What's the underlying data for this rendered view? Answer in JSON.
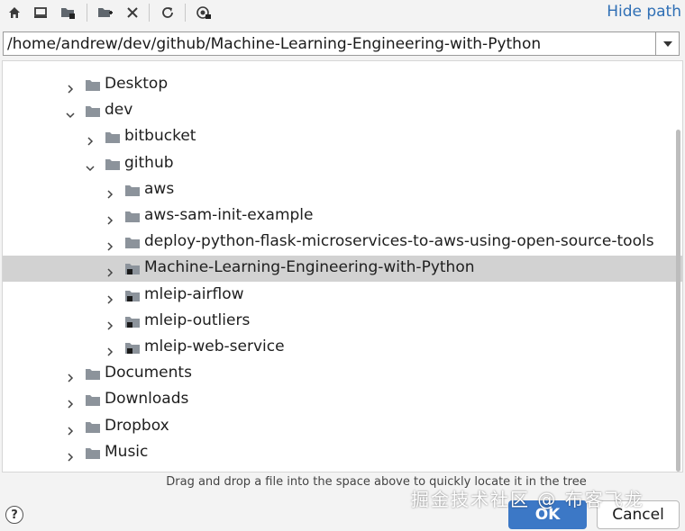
{
  "toolbar": {
    "buttons": [
      {
        "name": "home-icon"
      },
      {
        "name": "desktop-icon"
      },
      {
        "name": "project-folder-icon"
      },
      {
        "name": "new-folder-icon"
      },
      {
        "name": "delete-icon"
      },
      {
        "name": "refresh-icon"
      },
      {
        "name": "show-hidden-icon"
      }
    ],
    "hide_path_label": "Hide path"
  },
  "path": {
    "value": "/home/andrew/dev/github/Machine-Learning-Engineering-with-Python"
  },
  "tree": {
    "items": [
      {
        "label": "Desktop",
        "expanded": false,
        "icon": "folder-icon"
      },
      {
        "label": "dev",
        "expanded": true,
        "icon": "folder-icon"
      },
      {
        "label": "bitbucket",
        "expanded": false,
        "icon": "folder-icon"
      },
      {
        "label": "github",
        "expanded": true,
        "icon": "folder-icon"
      },
      {
        "label": "aws",
        "expanded": false,
        "icon": "folder-icon"
      },
      {
        "label": "aws-sam-init-example",
        "expanded": false,
        "icon": "folder-icon"
      },
      {
        "label": "deploy-python-flask-microservices-to-aws-using-open-source-tools",
        "expanded": false,
        "icon": "folder-icon"
      },
      {
        "label": "Machine-Learning-Engineering-with-Python",
        "expanded": false,
        "icon": "project-folder-icon",
        "selected": true
      },
      {
        "label": "mleip-airflow",
        "expanded": false,
        "icon": "project-folder-icon"
      },
      {
        "label": "mleip-outliers",
        "expanded": false,
        "icon": "project-folder-icon"
      },
      {
        "label": "mleip-web-service",
        "expanded": false,
        "icon": "project-folder-icon"
      },
      {
        "label": "Documents",
        "expanded": false,
        "icon": "folder-icon"
      },
      {
        "label": "Downloads",
        "expanded": false,
        "icon": "folder-icon"
      },
      {
        "label": "Dropbox",
        "expanded": false,
        "icon": "folder-icon"
      },
      {
        "label": "Music",
        "expanded": false,
        "icon": "folder-icon"
      }
    ]
  },
  "hint": "Drag and drop a file into the space above to quickly locate it in the tree",
  "footer": {
    "help_label": "?",
    "ok_label": "OK",
    "cancel_label": "Cancel"
  },
  "watermark": "掘金技术社区 @ 布客飞龙",
  "colors": {
    "accent": "#3c78c6",
    "link": "#2f6fb5",
    "selection": "#d2d2d2",
    "folder": "#8c939b"
  }
}
